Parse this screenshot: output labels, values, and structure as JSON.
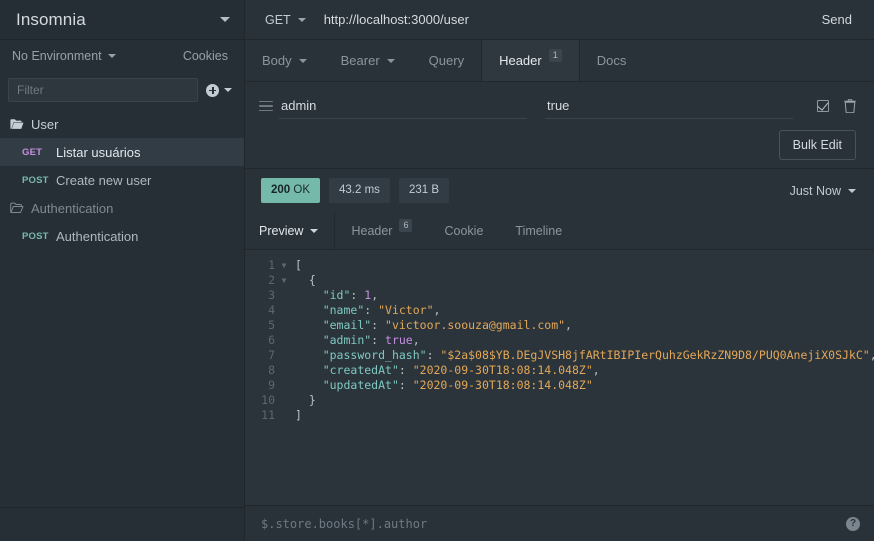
{
  "sidebar": {
    "workspace_title": "Insomnia",
    "environment_label": "No Environment",
    "cookies_label": "Cookies",
    "filter_placeholder": "Filter",
    "groups": [
      {
        "name": "User",
        "state": "open",
        "items": [
          {
            "method": "GET",
            "name": "Listar usuários",
            "active": true
          },
          {
            "method": "POST",
            "name": "Create new user",
            "active": false
          }
        ]
      },
      {
        "name": "Authentication",
        "state": "closed",
        "items": [
          {
            "method": "POST",
            "name": "Authentication",
            "active": false
          }
        ]
      }
    ]
  },
  "url_bar": {
    "method": "GET",
    "url": "http://localhost:3000/user",
    "send_label": "Send"
  },
  "request_tabs": [
    {
      "label": "Body",
      "caret": true,
      "active": false
    },
    {
      "label": "Bearer",
      "caret": true,
      "active": false
    },
    {
      "label": "Query",
      "caret": false,
      "active": false
    },
    {
      "label": "Header",
      "caret": false,
      "active": true,
      "badge": "1"
    },
    {
      "label": "Docs",
      "caret": false,
      "active": false
    }
  ],
  "headers_editor": {
    "rows": [
      {
        "key": "admin",
        "value": "true",
        "enabled": true
      }
    ],
    "bulk_edit_label": "Bulk Edit"
  },
  "response_status": {
    "status_code": "200",
    "status_text": "OK",
    "time": "43.2 ms",
    "size": "231 B",
    "history_label": "Just Now",
    "ok_color": "#74b9aa"
  },
  "response_tabs": [
    {
      "label": "Preview",
      "caret": true,
      "active": true
    },
    {
      "label": "Header",
      "caret": false,
      "active": false,
      "badge": "6"
    },
    {
      "label": "Cookie",
      "caret": false,
      "active": false
    },
    {
      "label": "Timeline",
      "caret": false,
      "active": false
    }
  ],
  "response_body": {
    "lines": [
      {
        "no": "1",
        "fold": true,
        "segments": [
          {
            "t": "[",
            "c": "p"
          }
        ]
      },
      {
        "no": "2",
        "fold": true,
        "segments": [
          {
            "t": "  {",
            "c": "p"
          }
        ]
      },
      {
        "no": "3",
        "fold": false,
        "segments": [
          {
            "t": "    ",
            "c": "p"
          },
          {
            "t": "\"id\"",
            "c": "k"
          },
          {
            "t": ": ",
            "c": "p"
          },
          {
            "t": "1",
            "c": "n"
          },
          {
            "t": ",",
            "c": "p"
          }
        ]
      },
      {
        "no": "4",
        "fold": false,
        "segments": [
          {
            "t": "    ",
            "c": "p"
          },
          {
            "t": "\"name\"",
            "c": "k"
          },
          {
            "t": ": ",
            "c": "p"
          },
          {
            "t": "\"Victor\"",
            "c": "s"
          },
          {
            "t": ",",
            "c": "p"
          }
        ]
      },
      {
        "no": "5",
        "fold": false,
        "segments": [
          {
            "t": "    ",
            "c": "p"
          },
          {
            "t": "\"email\"",
            "c": "k"
          },
          {
            "t": ": ",
            "c": "p"
          },
          {
            "t": "\"victoor.soouza@gmail.com\"",
            "c": "s"
          },
          {
            "t": ",",
            "c": "p"
          }
        ]
      },
      {
        "no": "6",
        "fold": false,
        "segments": [
          {
            "t": "    ",
            "c": "p"
          },
          {
            "t": "\"admin\"",
            "c": "k"
          },
          {
            "t": ": ",
            "c": "p"
          },
          {
            "t": "true",
            "c": "b"
          },
          {
            "t": ",",
            "c": "p"
          }
        ]
      },
      {
        "no": "7",
        "fold": false,
        "segments": [
          {
            "t": "    ",
            "c": "p"
          },
          {
            "t": "\"password_hash\"",
            "c": "k"
          },
          {
            "t": ": ",
            "c": "p"
          },
          {
            "t": "\"$2a$08$YB.DEgJVSH8jfARtIBIPIerQuhzGekRzZN9D8/PUQ0AnejiX0SJkC\"",
            "c": "s"
          },
          {
            "t": ",",
            "c": "p"
          }
        ]
      },
      {
        "no": "8",
        "fold": false,
        "segments": [
          {
            "t": "    ",
            "c": "p"
          },
          {
            "t": "\"createdAt\"",
            "c": "k"
          },
          {
            "t": ": ",
            "c": "p"
          },
          {
            "t": "\"2020-09-30T18:08:14.048Z\"",
            "c": "s"
          },
          {
            "t": ",",
            "c": "p"
          }
        ]
      },
      {
        "no": "9",
        "fold": false,
        "segments": [
          {
            "t": "    ",
            "c": "p"
          },
          {
            "t": "\"updatedAt\"",
            "c": "k"
          },
          {
            "t": ": ",
            "c": "p"
          },
          {
            "t": "\"2020-09-30T18:08:14.048Z\"",
            "c": "s"
          }
        ]
      },
      {
        "no": "10",
        "fold": false,
        "segments": [
          {
            "t": "  }",
            "c": "p"
          }
        ]
      },
      {
        "no": "11",
        "fold": false,
        "segments": [
          {
            "t": "]",
            "c": "p"
          }
        ]
      }
    ]
  },
  "filter_bar": {
    "placeholder": "$.store.books[*].author",
    "help_glyph": "?"
  }
}
